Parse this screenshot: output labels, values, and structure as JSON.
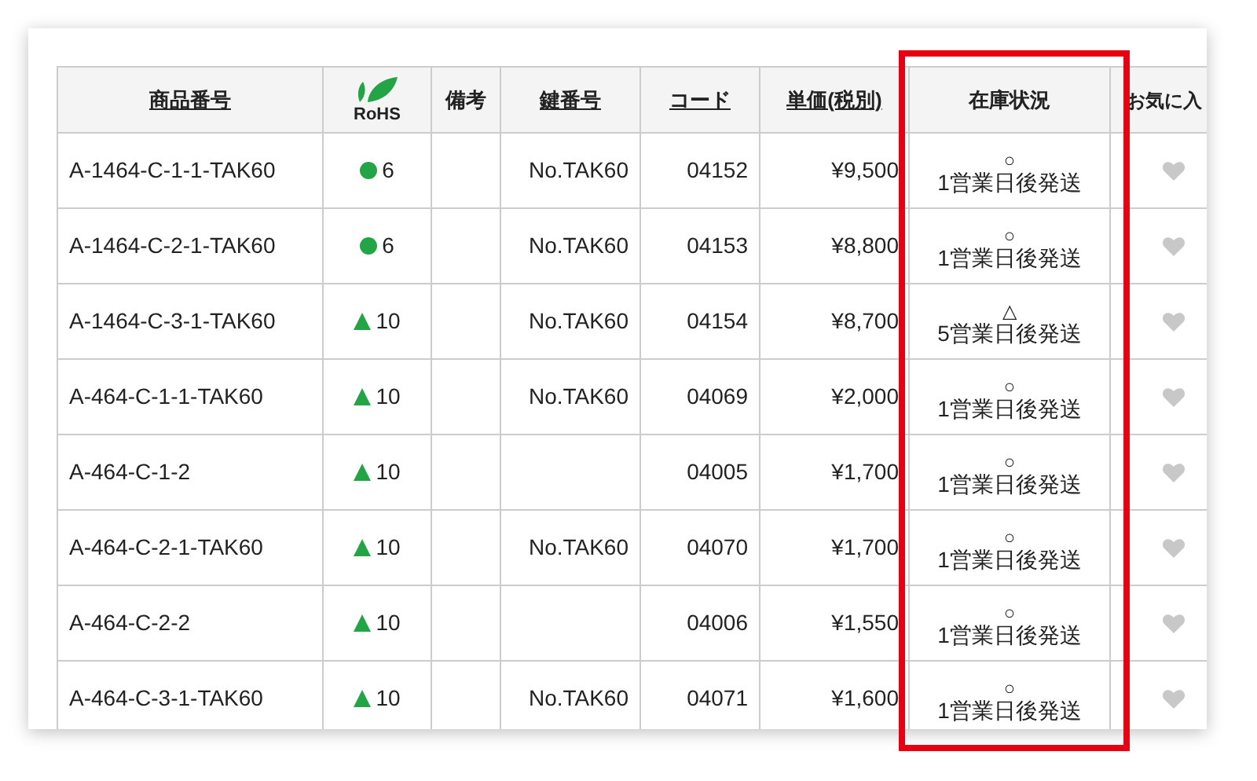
{
  "table": {
    "columns": [
      {
        "label": "商品番号",
        "kind": "text",
        "sortable": true
      },
      {
        "label": "RoHS",
        "kind": "rohs",
        "sortable": false
      },
      {
        "label": "備考",
        "kind": "text",
        "sortable": false
      },
      {
        "label": "鍵番号",
        "kind": "text",
        "sortable": true
      },
      {
        "label": "コード",
        "kind": "text",
        "sortable": true
      },
      {
        "label": "単価(税別)",
        "kind": "text",
        "sortable": true
      },
      {
        "label": "在庫状況",
        "kind": "text",
        "sortable": false,
        "highlighted": true
      },
      {
        "label": "お気に入",
        "kind": "text",
        "sortable": false
      }
    ],
    "rows": [
      {
        "item": "A-1464-C-1-1-TAK60",
        "kind": "circle",
        "stock": "6",
        "key": "No.TAK60",
        "code": "04152",
        "price": "¥9,500",
        "status_mark": "○",
        "status": "1営業日後発送"
      },
      {
        "item": "A-1464-C-2-1-TAK60",
        "kind": "circle",
        "stock": "6",
        "key": "No.TAK60",
        "code": "04153",
        "price": "¥8,800",
        "status_mark": "○",
        "status": "1営業日後発送"
      },
      {
        "item": "A-1464-C-3-1-TAK60",
        "kind": "triangle",
        "stock": "10",
        "key": "No.TAK60",
        "code": "04154",
        "price": "¥8,700",
        "status_mark": "△",
        "status": "5営業日後発送"
      },
      {
        "item": "A-464-C-1-1-TAK60",
        "kind": "triangle",
        "stock": "10",
        "key": "No.TAK60",
        "code": "04069",
        "price": "¥2,000",
        "status_mark": "○",
        "status": "1営業日後発送"
      },
      {
        "item": "A-464-C-1-2",
        "kind": "triangle",
        "stock": "10",
        "code": "04005",
        "price": "¥1,700",
        "status_mark": "○",
        "status": "1営業日後発送"
      },
      {
        "item": "A-464-C-2-1-TAK60",
        "kind": "triangle",
        "stock": "10",
        "key": "No.TAK60",
        "code": "04070",
        "price": "¥1,700",
        "status_mark": "○",
        "status": "1営業日後発送"
      },
      {
        "item": "A-464-C-2-2",
        "kind": "triangle",
        "stock": "10",
        "code": "04006",
        "price": "¥1,550",
        "status_mark": "○",
        "status": "1営業日後発送"
      },
      {
        "item": "A-464-C-3-1-TAK60",
        "kind": "triangle",
        "stock": "10",
        "key": "No.TAK60",
        "code": "04071",
        "price": "¥1,600",
        "status_mark": "○",
        "status": "1営業日後発送"
      }
    ]
  }
}
